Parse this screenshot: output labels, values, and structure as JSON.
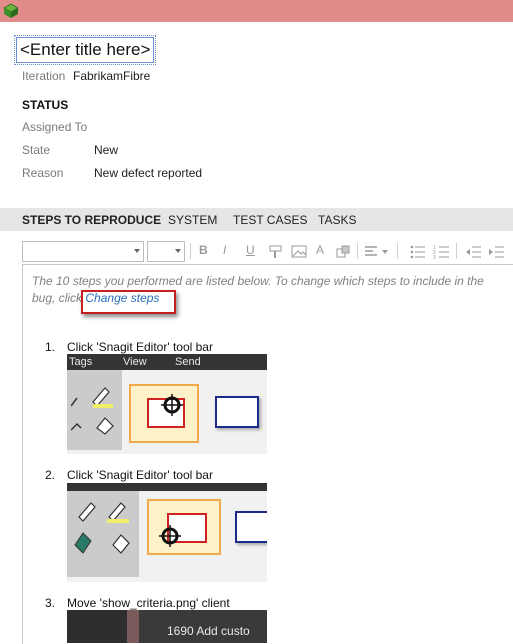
{
  "work_item": {
    "title_field": "<Enter title here>",
    "iteration_label": "Iteration",
    "iteration_value": "FabrikamFibre"
  },
  "status": {
    "heading": "STATUS",
    "assigned_to_label": "Assigned To",
    "assigned_to_value": "",
    "state_label": "State",
    "state_value": "New",
    "reason_label": "Reason",
    "reason_value": "New defect reported"
  },
  "tabs": [
    {
      "label": "STEPS TO REPRODUCE",
      "active": true
    },
    {
      "label": "SYSTEM",
      "active": false
    },
    {
      "label": "TEST CASES",
      "active": false
    },
    {
      "label": "TASKS",
      "active": false
    }
  ],
  "editor": {
    "hint_text": "The 10 steps you performed are listed below. To change which steps to include in the bug, click",
    "change_steps_link": "Change steps",
    "steps": [
      {
        "num": "1.",
        "text": "Click 'Snagit Editor' tool bar"
      },
      {
        "num": "2.",
        "text": "Click 'Snagit Editor' tool bar"
      },
      {
        "num": "3.",
        "text": "Move 'show_criteria.png' client"
      }
    ]
  },
  "screenshots": {
    "menu_tags": "Tags",
    "menu_view": "View",
    "menu_send": "Send",
    "step3_caption": "1690 Add custo"
  },
  "colors": {
    "titlebar": "#e08c8a",
    "callout": "#c42020",
    "link": "#2a6ebb"
  }
}
